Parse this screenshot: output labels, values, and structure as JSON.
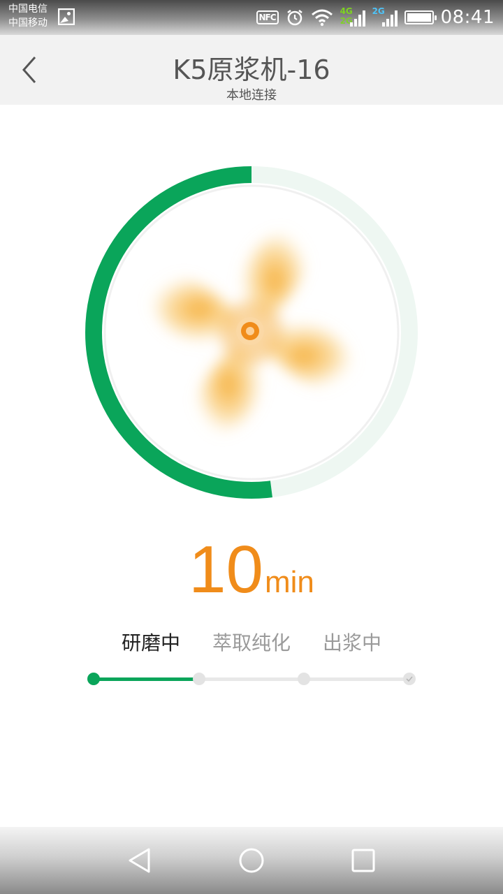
{
  "status_bar": {
    "carrier_1": "中国电信",
    "carrier_2": "中国移动",
    "nfc": "NFC",
    "network_1": "4G",
    "network_1_sub": "2G",
    "network_2": "2G",
    "time": "08:41",
    "icons": [
      "gallery-icon",
      "nfc-icon",
      "alarm-icon",
      "wifi-icon",
      "signal-icon",
      "signal-icon",
      "battery-icon"
    ]
  },
  "header": {
    "title": "K5原浆机-16",
    "subtitle": "本地连接",
    "back_icon": "chevron-left-icon"
  },
  "dial": {
    "progress": 0.52,
    "progress_color": "#0aa55a",
    "track_color": "#eef7f2",
    "fan_color": "#f8c25c",
    "center_color": "#f08c1a"
  },
  "timer": {
    "value": "10",
    "unit": "min"
  },
  "stages": {
    "items": [
      "研磨中",
      "萃取纯化",
      "出浆中"
    ],
    "active_index": 0,
    "progress": 0.33
  },
  "nav_bar": {
    "icons": [
      "back-triangle-icon",
      "home-circle-icon",
      "recent-square-icon"
    ]
  }
}
